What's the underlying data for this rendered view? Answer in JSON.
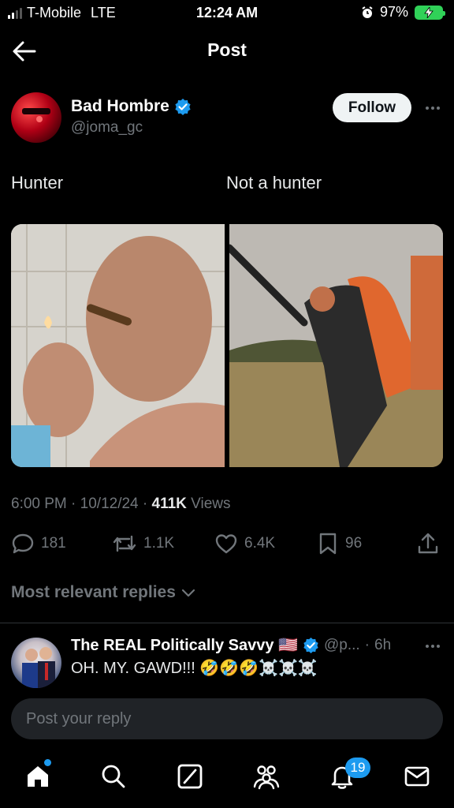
{
  "status_bar": {
    "carrier": "T-Mobile",
    "network": "LTE",
    "time": "12:24 AM",
    "battery": "97%"
  },
  "header": {
    "title": "Post"
  },
  "post": {
    "author_name": "Bad Hombre",
    "author_handle": "@joma_gc",
    "follow_label": "Follow",
    "caption_left": "Hunter",
    "caption_right": "Not a hunter",
    "time": "6:00 PM",
    "date": "10/12/24",
    "views_count": "411K",
    "views_label": "Views",
    "replies": "181",
    "reposts": "1.1K",
    "likes": "6.4K",
    "bookmarks": "96"
  },
  "replies_section": {
    "label": "Most relevant replies"
  },
  "reply": {
    "name": "The REAL Politically Savvy 🇺🇸",
    "handle": "@p...",
    "time": "6h",
    "text": "OH. MY. GAWD!!! 🤣🤣🤣☠️☠️☠️"
  },
  "composer": {
    "placeholder": "Post your reply"
  },
  "tabbar": {
    "notifications_badge": "19"
  },
  "colors": {
    "accent": "#1d9bf0",
    "background": "#000000",
    "muted": "#71767b",
    "battery": "#30d158"
  }
}
